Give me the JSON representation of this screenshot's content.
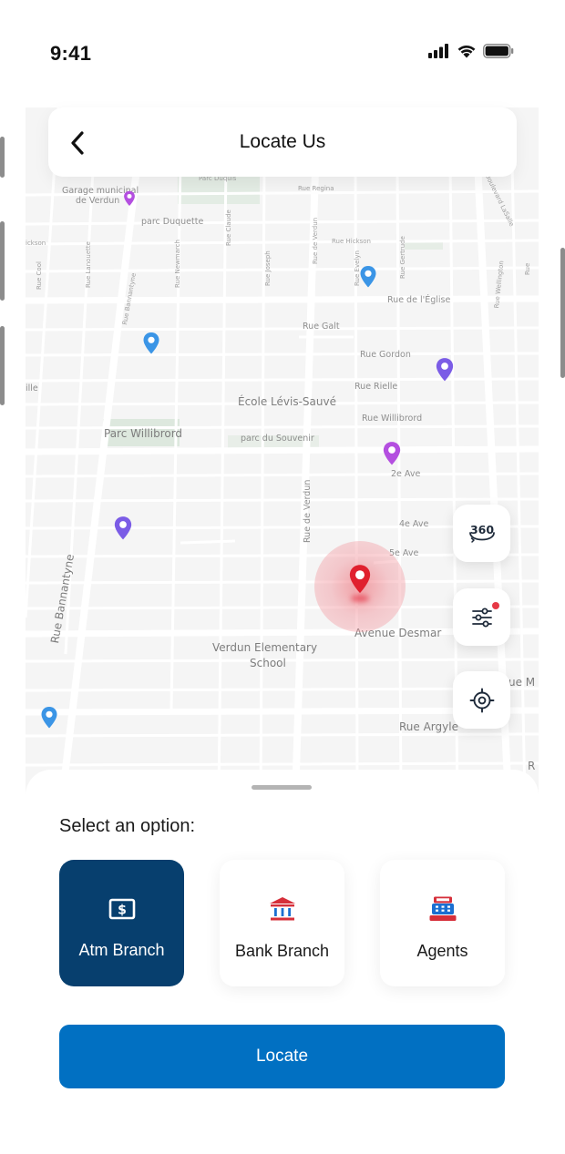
{
  "status_bar": {
    "time": "9:41",
    "icons": [
      "signal-icon",
      "wifi-icon",
      "battery-icon"
    ]
  },
  "header": {
    "title": "Locate Us",
    "back_icon": "chevron-left-icon"
  },
  "map": {
    "labels": {
      "garage1": "Garage municipal",
      "garage2": "de Verdun",
      "parc_duquette": "parc Duquette",
      "parc_duquis": "Parc Duquis",
      "rue_regina": "Rue Regina",
      "boulevard_lasalle": "Boulevard LaSalle",
      "rue_hickson_left": "ickson",
      "rue_hickson": "Rue Hickson",
      "rue_de_leglise": "Rue de l'Église",
      "rue_galt": "Rue Galt",
      "rue_gordon": "Rue Gordon",
      "rue_rielle": "Rue Rielle",
      "rue_rielle_left": "ille",
      "ecole_levis_sauve": "École Lévis-Sauvé",
      "rue_willibrord": "Rue Willibrord",
      "parc_willibrord": "Parc Willibrord",
      "parc_du_souvenir": "parc du Souvenir",
      "deuxieme_ave": "2e Ave",
      "quatrieme_ave": "4e Ave",
      "cinquieme_ave": "5e Ave",
      "rue_de_verdun": "Rue de Verdun",
      "rue_bannantyne": "Rue Bannantyne",
      "avenue_desmar": "Avenue Desmar",
      "verdun_elementary_1": "Verdun Elementary",
      "verdun_elementary_2": "School",
      "rue_argyle": "Rue Argyle",
      "rue_m_edge": "ue M",
      "r_edge": "R",
      "rue_cool": "Rue Cool",
      "rue_lanouette": "Rue Lanouette",
      "rue_bannantyne_top": "Rue Bannantyne",
      "rue_newmarch": "Rue Newmarch",
      "rue_claude": "Rue Claude",
      "rue_joseph": "Rue Joseph",
      "rue_de_verdun_top": "Rue de Verdun",
      "rue_evelyn": "Rue Evelyn",
      "rue_gertrude": "Rue Gertrude",
      "rue_wellington": "Rue Wellington",
      "rue_edge_right": "Rue"
    },
    "pins": [
      {
        "name": "atm-pin",
        "color": "#3b95e6"
      },
      {
        "name": "agent-pin",
        "color": "#7b5ce6"
      },
      {
        "name": "bank-pin",
        "color": "#b44fe0"
      }
    ],
    "current_location_color": "#e0202e"
  },
  "map_controls": {
    "view_360_label": "360",
    "filter_icon": "sliders-icon",
    "recenter_icon": "crosshair-icon"
  },
  "sheet": {
    "title": "Select an option:",
    "options": [
      {
        "label": "Atm Branch",
        "icon": "atm-dollar-icon",
        "selected": true
      },
      {
        "label": "Bank Branch",
        "icon": "bank-building-icon",
        "selected": false
      },
      {
        "label": "Agents",
        "icon": "cash-register-icon",
        "selected": false
      }
    ],
    "locate_label": "Locate"
  },
  "colors": {
    "primary": "#0170c2",
    "selected_option": "#073f6e",
    "accent_red": "#e63946",
    "icon_blue": "#1b6fd1"
  }
}
